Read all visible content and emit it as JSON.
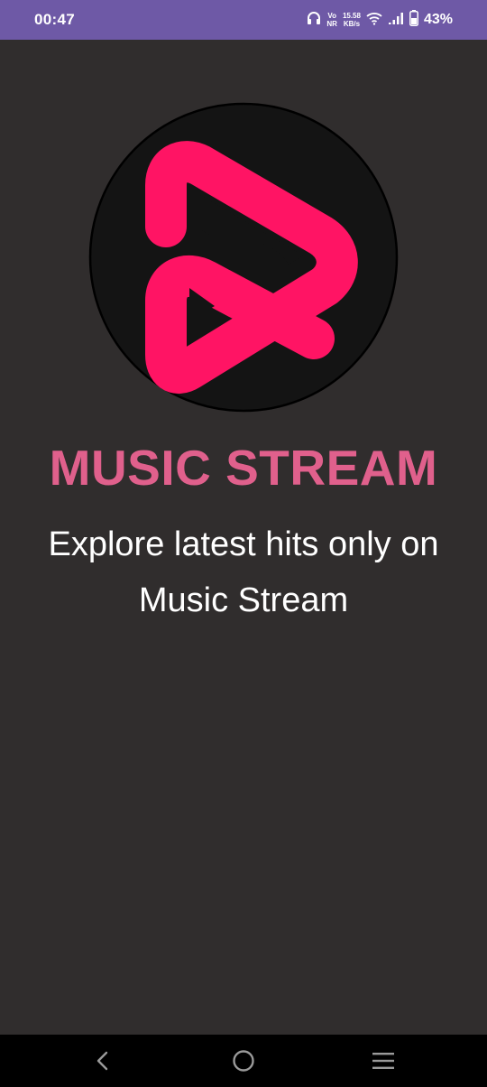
{
  "status_bar": {
    "time": "00:47",
    "net_type_top": "Vo",
    "net_type_bottom": "NR",
    "speed_value": "15.58",
    "speed_unit": "KB/s",
    "battery_percent": "43%",
    "icons": [
      "headphones-icon",
      "wifi-icon",
      "signal-icon",
      "battery-icon"
    ],
    "color": "#6e59a6"
  },
  "splash": {
    "title": "MUSIC STREAM",
    "tagline": "Explore latest hits only on Music Stream",
    "title_color": "#e0608c",
    "logo_color": "#ff1464"
  },
  "nav_bar": {
    "icons": [
      "back-icon",
      "home-icon",
      "recents-menu-icon"
    ]
  }
}
